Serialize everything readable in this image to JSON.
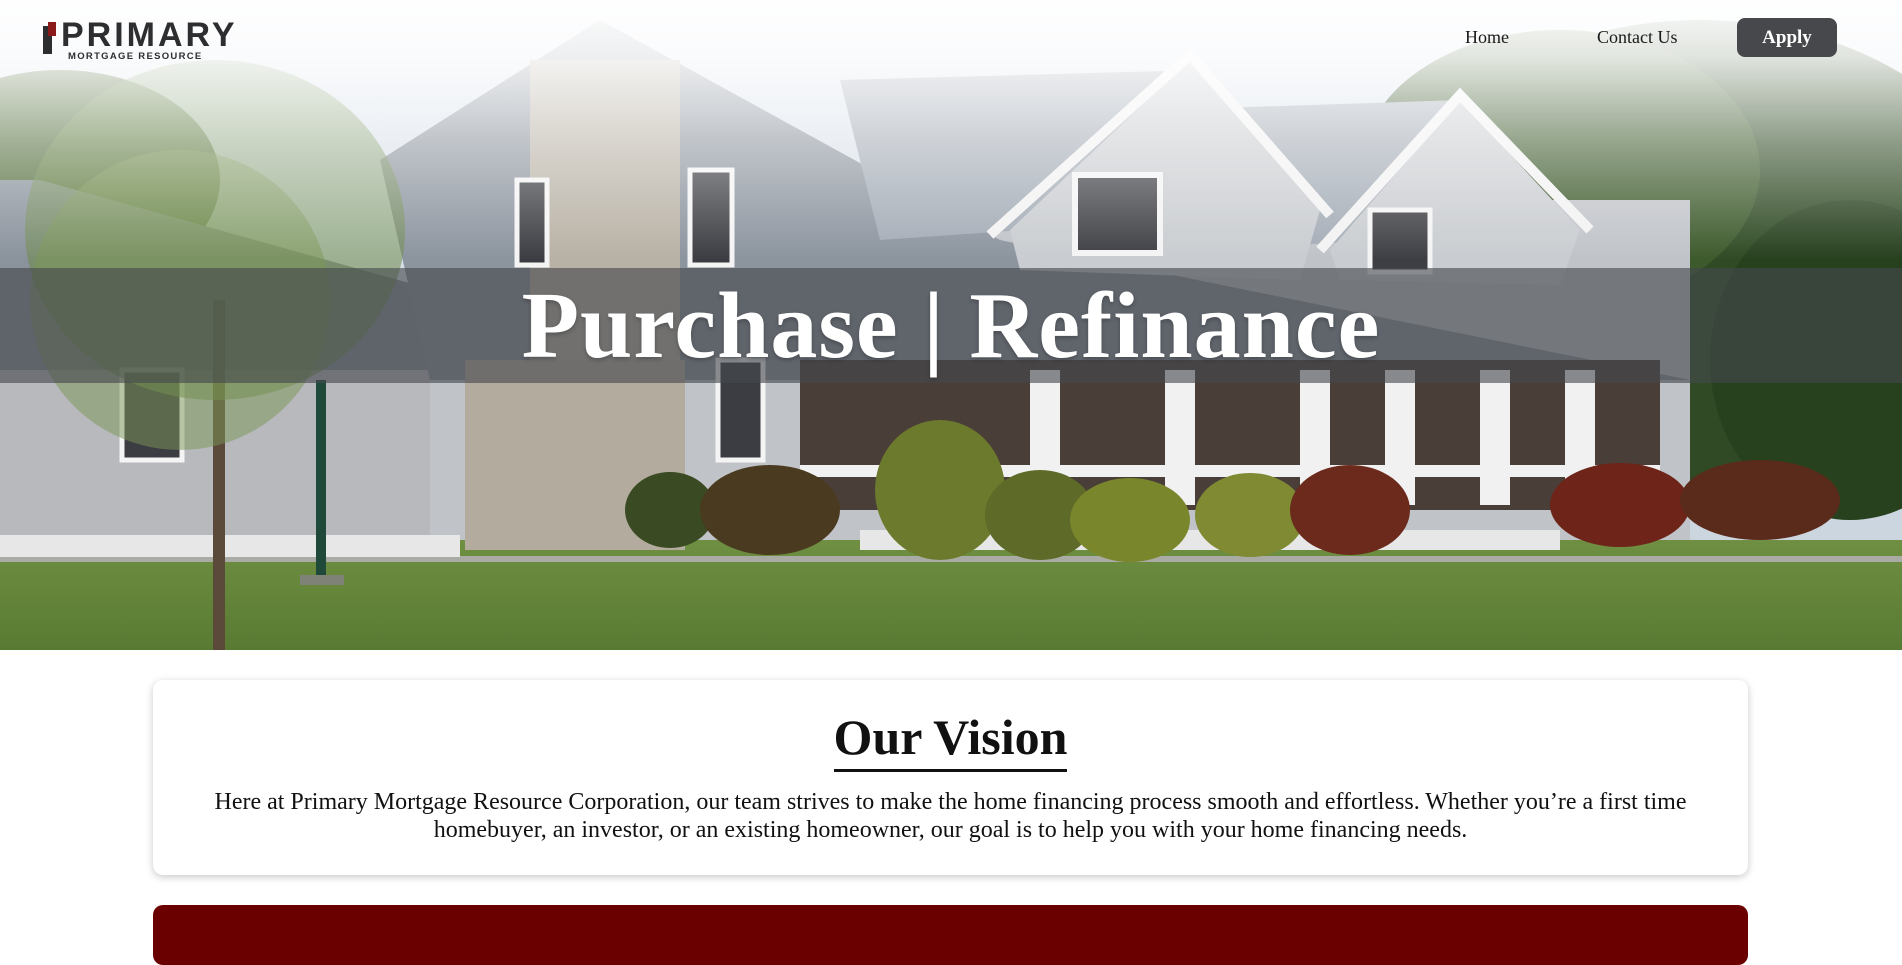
{
  "header": {
    "logo": {
      "word": "PRIMARY",
      "sub": "MORTGAGE RESOURCE",
      "mark_color": "#8b1a1a"
    },
    "nav": {
      "home_label": "Home",
      "contact_label": "Contact Us",
      "apply_label": "Apply"
    }
  },
  "hero": {
    "title": "Purchase | Refinance",
    "image_subject": "house-photo"
  },
  "vision": {
    "title": "Our Vision",
    "text": "Here at Primary Mortgage Resource Corporation, our team strives to make the home financing process smooth and effortless. Whether you’re a first time homebuyer, an investor, or an existing homeowner, our goal is to help you with your home financing needs."
  },
  "colors": {
    "apply_button": "#47484b",
    "accent_red": "#6b0000"
  }
}
